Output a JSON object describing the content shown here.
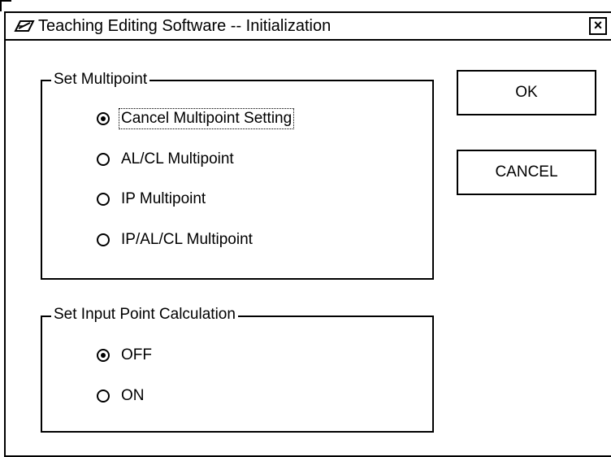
{
  "window": {
    "title": "Teaching Editing Software -- Initialization",
    "app_icon": "pencil-tablet-icon",
    "close_label": "×"
  },
  "multipoint_group": {
    "label": "Set Multipoint",
    "selected_index": 0,
    "options": [
      {
        "label": "Cancel Multipoint Setting",
        "checked": true
      },
      {
        "label": "AL/CL Multipoint",
        "checked": false
      },
      {
        "label": "IP Multipoint",
        "checked": false
      },
      {
        "label": "IP/AL/CL Multipoint",
        "checked": false
      }
    ]
  },
  "input_point_group": {
    "label": "Set Input Point Calculation",
    "selected_index": 0,
    "options": [
      {
        "label": "OFF",
        "checked": true
      },
      {
        "label": "ON",
        "checked": false
      }
    ]
  },
  "buttons": {
    "ok_label": "OK",
    "cancel_label": "CANCEL"
  }
}
